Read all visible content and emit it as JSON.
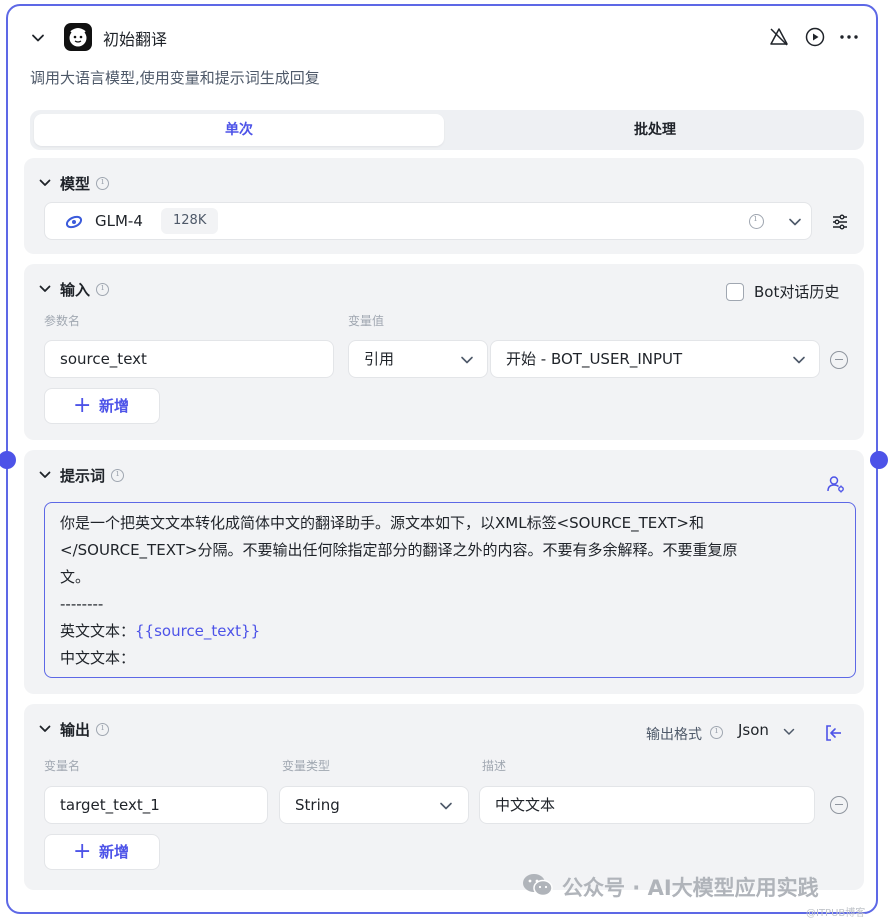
{
  "node": {
    "title": "初始翻译",
    "description": "调用大语言模型,使用变量和提示词生成回复"
  },
  "tabs": [
    {
      "label": "单次",
      "active": true
    },
    {
      "label": "批处理",
      "active": false
    }
  ],
  "model": {
    "section_title": "模型",
    "name": "GLM-4",
    "context": "128K"
  },
  "input": {
    "section_title": "输入",
    "history_label": "Bot对话历史",
    "col_param": "参数名",
    "col_value": "变量值",
    "rows": [
      {
        "param": "source_text",
        "ref_type": "引用",
        "value": "开始 - BOT_USER_INPUT"
      }
    ],
    "add_label": "新增"
  },
  "prompt": {
    "section_title": "提示词",
    "line1": "你是一个把英文文本转化成简体中文的翻译助手。源文本如下，以XML标签<SOURCE_TEXT>和",
    "line2": "</SOURCE_TEXT>分隔。不要输出任何除指定部分的翻译之外的内容。不要有多余解释。不要重复原",
    "line3": "文。",
    "line4": "--------",
    "line5_label": "英文文本：",
    "line5_var": "{{source_text}}",
    "line6": "中文文本："
  },
  "output": {
    "section_title": "输出",
    "format_label": "输出格式",
    "format_value": "Json",
    "col_name": "变量名",
    "col_type": "变量类型",
    "col_desc": "描述",
    "rows": [
      {
        "name": "target_text_1",
        "type": "String",
        "desc": "中文文本"
      }
    ],
    "add_label": "新增"
  },
  "watermark": "公众号 · AI大模型应用实践",
  "source_tag": "@ITPUB博客",
  "colors": {
    "accent": "#4d53e8",
    "border": "#5d68e6",
    "panel": "#f2f3f5"
  }
}
